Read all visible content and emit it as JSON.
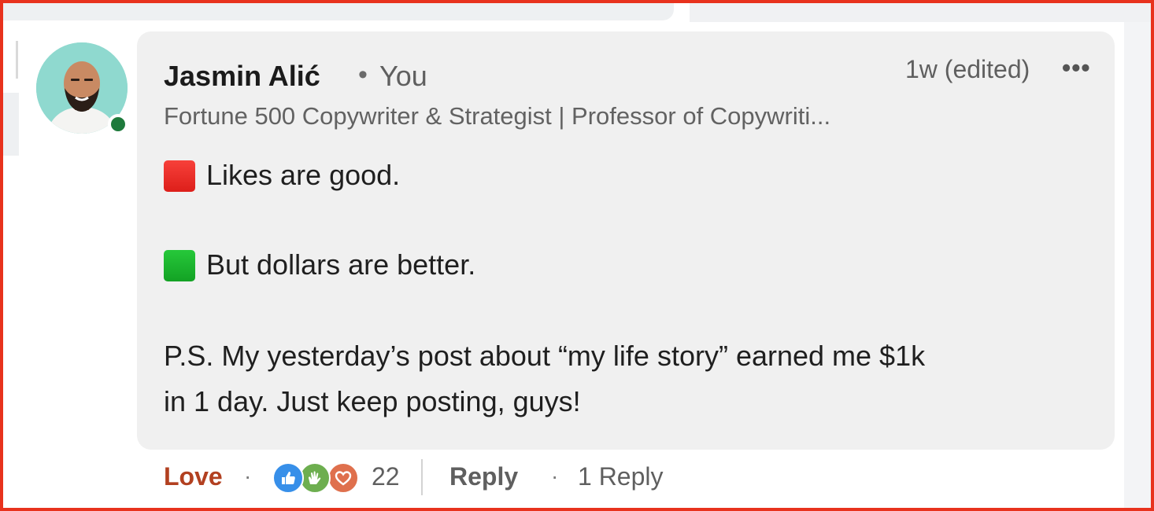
{
  "comment": {
    "author": {
      "name": "Jasmin Alić",
      "separator": "•",
      "relation": "You",
      "headline": "Fortune 500 Copywriter & Strategist | Professor of Copywriti..."
    },
    "timestamp": "1w (edited)",
    "more_label": "•••",
    "body_lines": [
      "Likes are good.",
      "But dollars are better.",
      "P.S. My yesterday’s post about “my life story” earned me $1k",
      "in 1 day. Just keep posting, guys!"
    ],
    "bullet_colors": {
      "red": "#e8271f",
      "green": "#1bb52e"
    },
    "presence_color": "#1e7a3c"
  },
  "actions": {
    "love_label": "Love",
    "separator": "·",
    "reaction_count": "22",
    "reactions": [
      "like-icon",
      "celebrate-icon",
      "love-icon"
    ],
    "reply_label": "Reply",
    "reply_count_label": "1 Reply"
  },
  "colors": {
    "frame": "#e8321d",
    "bubble": "#f0f0f0",
    "love_action": "#b24020"
  }
}
